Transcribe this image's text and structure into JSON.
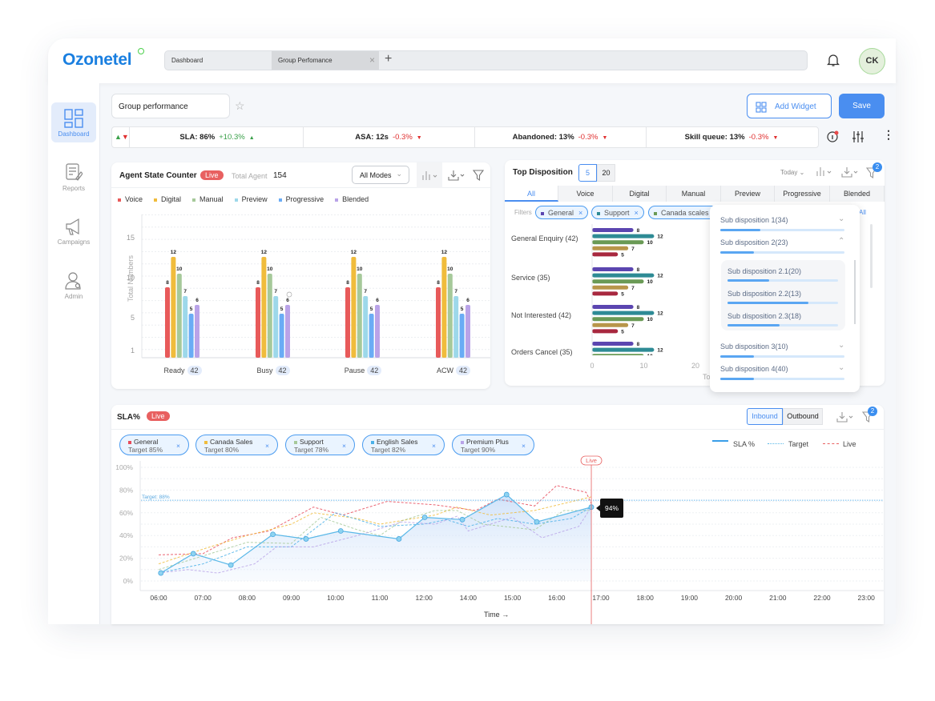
{
  "header": {
    "logo": "Ozonetel",
    "tabs": [
      {
        "label": "Dashboard",
        "active": false
      },
      {
        "label": "Group Perfomance",
        "active": true
      }
    ],
    "add_tab": "+",
    "close_tab": "×",
    "avatar": "CK"
  },
  "sidebar": {
    "items": [
      {
        "label": "Dashboard",
        "icon": "dashboard-icon",
        "active": true
      },
      {
        "label": "Reports",
        "icon": "reports-icon"
      },
      {
        "label": "Campaigns",
        "icon": "megaphone-icon"
      },
      {
        "label": "Admin",
        "icon": "admin-icon"
      }
    ]
  },
  "toolbar": {
    "dashboard_name": "Group performance",
    "add_widget": "Add Widget",
    "save": "Save"
  },
  "kpis": [
    {
      "label": "SLA: 86%",
      "change": "+10.3%",
      "trend": "up"
    },
    {
      "label": "ASA: 12s",
      "change": "-0.3%",
      "trend": "down"
    },
    {
      "label": "Abandoned: 13%",
      "change": "-0.3%",
      "trend": "down"
    },
    {
      "label": "Skill queue: 13%",
      "change": "-0.3%",
      "trend": "down"
    }
  ],
  "colors": {
    "accent": "#4a8ef0",
    "up": "#3aa04a",
    "down": "#e03030",
    "live": "#e86060"
  },
  "agent_state": {
    "title": "Agent State Counter",
    "live": "Live",
    "total_label": "Total Agent",
    "total": "154",
    "mode": "All Modes"
  },
  "top_disposition": {
    "title": "Top Disposition",
    "counts": [
      "5",
      "20"
    ],
    "period": "Today",
    "tabs": [
      "All",
      "Voice",
      "Digital",
      "Manual",
      "Preview",
      "Progressive",
      "Blended"
    ],
    "filters_label": "Filters",
    "filters": [
      {
        "label": "General",
        "color": "#5b45b0"
      },
      {
        "label": "Support",
        "color": "#2e8b95"
      },
      {
        "label": "Canada scales",
        "color": "#6a9a55"
      }
    ],
    "clear_all": "All",
    "filter_count": "2"
  },
  "sub_dispositions": [
    {
      "label": "Sub disposition 1(34)",
      "fill": 0.32,
      "expanded": false
    },
    {
      "label": "Sub disposition 2(23)",
      "fill": 0.27,
      "expanded": true,
      "children": [
        {
          "label": "Sub disposition 2.1(20)",
          "fill": 0.38
        },
        {
          "label": "Sub disposition 2.2(13)",
          "fill": 0.73
        },
        {
          "label": "Sub disposition 2.3(18)",
          "fill": 0.47
        }
      ]
    },
    {
      "label": "Sub disposition 3(10)",
      "fill": 0.27,
      "expanded": false
    },
    {
      "label": "Sub disposition 4(40)",
      "fill": 0.27,
      "expanded": false
    }
  ],
  "sla": {
    "title": "SLA%",
    "live": "Live",
    "toggle": [
      "Inbound",
      "Outbound"
    ],
    "filter_count": "2",
    "chips": [
      {
        "name": "General",
        "target": "Target 85%",
        "color": "#e84a5a"
      },
      {
        "name": "Canada Sales",
        "target": "Target 80%",
        "color": "#f0bc3c"
      },
      {
        "name": "Support",
        "target": "Target 78%",
        "color": "#a6c99a"
      },
      {
        "name": "English Sales",
        "target": "Target 82%",
        "color": "#4ab0e8"
      },
      {
        "name": "Premium Plus",
        "target": "Target 90%",
        "color": "#b9a3e8"
      }
    ],
    "legend": [
      "SLA %",
      "Target",
      "Live"
    ],
    "tooltip": "94%",
    "live_marker": "Live",
    "target_label": "Target: 88%"
  },
  "chart_data": [
    {
      "type": "bar",
      "categories": [
        "Ready",
        "Busy",
        "Pause",
        "ACW"
      ],
      "category_badges": [
        "42",
        "42",
        "42",
        "42"
      ],
      "ylabel": "Total Numbers",
      "yticks": [
        1,
        5,
        10,
        15
      ],
      "ylim": [
        0,
        18
      ],
      "grid": true,
      "legend": "top-left",
      "series": [
        {
          "name": "Voice",
          "color": "#e85a5a",
          "values": [
            8,
            8,
            8,
            8
          ]
        },
        {
          "name": "Digital",
          "color": "#f0bc3c",
          "values": [
            12,
            12,
            12,
            12
          ]
        },
        {
          "name": "Manual",
          "color": "#a6c99a",
          "values": [
            10,
            10,
            10,
            10
          ]
        },
        {
          "name": "Preview",
          "color": "#9dd8ea",
          "values": [
            7,
            7,
            7,
            7
          ]
        },
        {
          "name": "Progressive",
          "color": "#6aacf5",
          "values": [
            5,
            5,
            5,
            5
          ]
        },
        {
          "name": "Blended",
          "color": "#b9a3e8",
          "values": [
            6,
            6,
            6,
            6
          ]
        }
      ]
    },
    {
      "type": "bar",
      "orientation": "horizontal",
      "categories": [
        "General Enquiry (42)",
        "Service (35)",
        "Not Interested (42)",
        "Orders Cancel (35)"
      ],
      "xticks": [
        0,
        10,
        20
      ],
      "xlabel": "Total",
      "series": [
        {
          "color": "#5b45b0",
          "values": [
            8,
            8,
            8,
            8
          ]
        },
        {
          "color": "#2e8b95",
          "values": [
            12,
            12,
            12,
            12
          ]
        },
        {
          "color": "#6a9a55",
          "values": [
            10,
            10,
            10,
            10
          ]
        },
        {
          "color": "#b8964a",
          "values": [
            7,
            7,
            7,
            7
          ]
        },
        {
          "color": "#a8283f",
          "values": [
            5,
            5,
            5,
            5
          ]
        }
      ]
    },
    {
      "type": "line",
      "xlabel": "Time",
      "xticks": [
        "06:00",
        "07:00",
        "08:00",
        "09:00",
        "10:00",
        "11:00",
        "12:00",
        "14:00",
        "15:00",
        "16:00",
        "17:00",
        "18:00",
        "19:00",
        "20:00",
        "21:00",
        "22:00",
        "23:00"
      ],
      "yticks": [
        "0%",
        "20%",
        "40%",
        "60%",
        "80%",
        "100%"
      ],
      "ylim": [
        0,
        100
      ],
      "grid": true,
      "target_line_y": 71,
      "live_time": "16:47",
      "sla": {
        "name": "SLA %",
        "color": "#5ab8e8",
        "points": [
          [
            "06:03",
            7
          ],
          [
            "06:47",
            24
          ],
          [
            "07:38",
            14
          ],
          [
            "08:35",
            41
          ],
          [
            "09:20",
            37
          ],
          [
            "10:07",
            44
          ],
          [
            "11:26",
            37
          ],
          [
            "12:02",
            56
          ],
          [
            "13:44",
            54
          ],
          [
            "14:52",
            76
          ],
          [
            "15:33",
            52
          ],
          [
            "16:47",
            65
          ]
        ]
      },
      "series": [
        {
          "name": "General",
          "color": "#e84a5a",
          "points": [
            [
              "06:00",
              23
            ],
            [
              "07:00",
              24
            ],
            [
              "07:40",
              38
            ],
            [
              "08:30",
              44
            ],
            [
              "09:30",
              65
            ],
            [
              "10:10",
              58
            ],
            [
              "11:10",
              70
            ],
            [
              "12:30",
              67
            ],
            [
              "14:10",
              62
            ],
            [
              "14:40",
              72
            ],
            [
              "15:30",
              66
            ],
            [
              "16:00",
              84
            ],
            [
              "16:40",
              78
            ],
            [
              "16:47",
              68
            ]
          ]
        },
        {
          "name": "Canada Sales",
          "color": "#f0bc3c",
          "points": [
            [
              "06:00",
              15
            ],
            [
              "07:00",
              28
            ],
            [
              "08:00",
              40
            ],
            [
              "09:00",
              50
            ],
            [
              "09:30",
              60
            ],
            [
              "10:30",
              55
            ],
            [
              "11:00",
              50
            ],
            [
              "12:30",
              58
            ],
            [
              "13:30",
              65
            ],
            [
              "14:30",
              58
            ],
            [
              "15:30",
              62
            ],
            [
              "16:47",
              74
            ]
          ]
        },
        {
          "name": "Support",
          "color": "#a6c99a",
          "points": [
            [
              "06:00",
              10
            ],
            [
              "07:00",
              22
            ],
            [
              "08:00",
              34
            ],
            [
              "09:00",
              33
            ],
            [
              "09:40",
              56
            ],
            [
              "10:30",
              45
            ],
            [
              "11:00",
              40
            ],
            [
              "11:30",
              53
            ],
            [
              "12:30",
              62
            ],
            [
              "13:30",
              62
            ],
            [
              "14:20",
              50
            ],
            [
              "15:30",
              45
            ],
            [
              "16:10",
              62
            ],
            [
              "16:47",
              62
            ]
          ]
        },
        {
          "name": "English Sales",
          "color": "#4ab0e8",
          "points": [
            [
              "06:00",
              7
            ],
            [
              "07:00",
              15
            ],
            [
              "08:00",
              30
            ],
            [
              "09:00",
              30
            ],
            [
              "10:00",
              60
            ],
            [
              "11:00",
              48
            ],
            [
              "12:00",
              50
            ],
            [
              "13:00",
              54
            ],
            [
              "14:00",
              48
            ],
            [
              "14:40",
              55
            ],
            [
              "15:30",
              50
            ],
            [
              "16:20",
              55
            ],
            [
              "16:47",
              65
            ]
          ]
        },
        {
          "name": "Premium Plus",
          "color": "#b9a3e8",
          "points": [
            [
              "06:00",
              7
            ],
            [
              "06:40",
              10
            ],
            [
              "07:20",
              7
            ],
            [
              "08:10",
              15
            ],
            [
              "08:40",
              30
            ],
            [
              "09:30",
              30
            ],
            [
              "10:30",
              40
            ],
            [
              "11:30",
              52
            ],
            [
              "12:30",
              50
            ],
            [
              "13:30",
              57
            ],
            [
              "14:00",
              44
            ],
            [
              "15:00",
              56
            ],
            [
              "15:40",
              38
            ],
            [
              "16:30",
              48
            ],
            [
              "16:47",
              65
            ]
          ]
        }
      ]
    }
  ]
}
